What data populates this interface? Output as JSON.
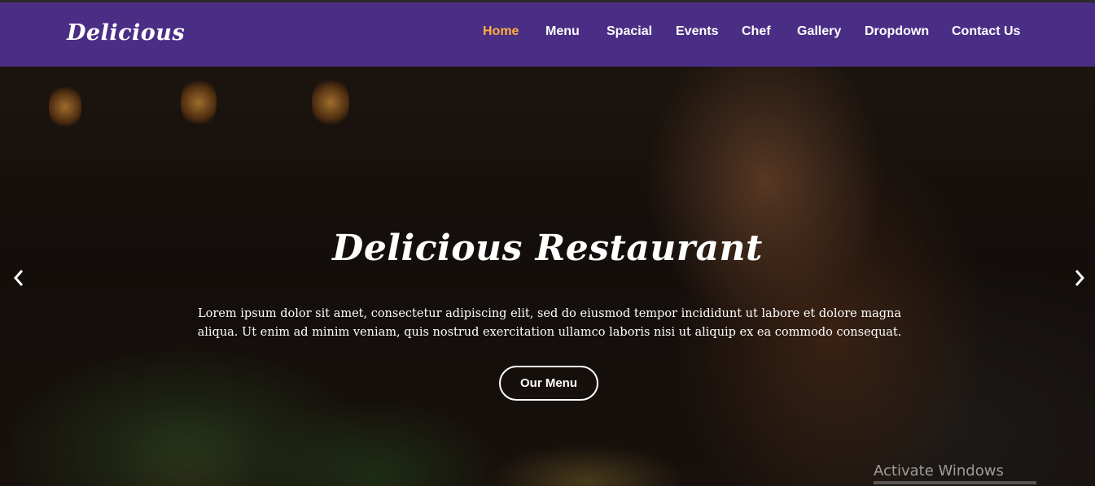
{
  "brand": {
    "name": "Delicious"
  },
  "nav": {
    "items": [
      {
        "label": "Home",
        "active": true
      },
      {
        "label": "Menu"
      },
      {
        "label": "Spacial"
      },
      {
        "label": "Events"
      },
      {
        "label": "Chef"
      },
      {
        "label": "Gallery"
      },
      {
        "label": "Dropdown"
      },
      {
        "label": "Contact Us"
      }
    ]
  },
  "hero": {
    "title": "Delicious Restaurant",
    "text": "Lorem ipsum dolor sit amet, consectetur adipiscing elit, sed do eiusmod tempor incididunt ut labore et dolore magna aliqua. Ut enim ad minim veniam, quis nostrud exercitation ullamco laboris nisi ut aliquip ex ea commodo consequat.",
    "button_label": "Our Menu",
    "prev_icon": "chevron-left-icon",
    "next_icon": "chevron-right-icon"
  },
  "system": {
    "watermark": "Activate Windows"
  },
  "colors": {
    "navbar": "#4a2e85",
    "active_link": "#ffb03b",
    "text": "#ffffff"
  }
}
